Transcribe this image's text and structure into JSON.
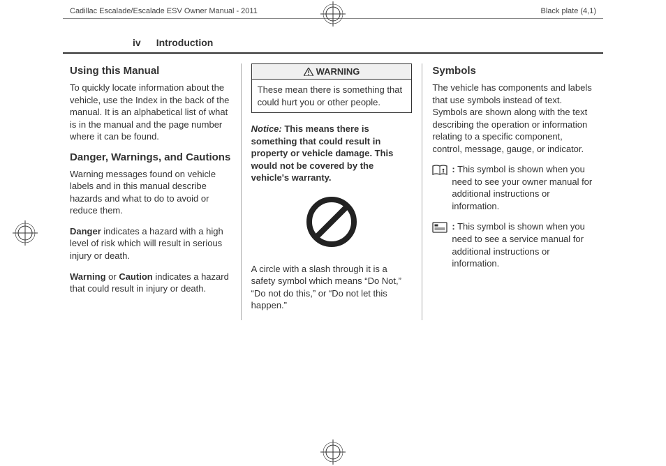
{
  "header": {
    "left": "Cadillac Escalade/Escalade ESV Owner Manual - 2011",
    "right": "Black plate (4,1)"
  },
  "page": {
    "number": "iv",
    "section": "Introduction"
  },
  "col1": {
    "h1": "Using this Manual",
    "p1": "To quickly locate information about the vehicle, use the Index in the back of the manual. It is an alphabetical list of what is in the manual and the page number where it can be found.",
    "h2": "Danger, Warnings, and Cautions",
    "p2": "Warning messages found on vehicle labels and in this manual describe hazards and what to do to avoid or reduce them.",
    "p3a": "Danger",
    "p3b": " indicates a hazard with a high level of risk which will result in serious injury or death.",
    "p4a": "Warning",
    "p4b": " or ",
    "p4c": "Caution",
    "p4d": " indicates a hazard that could result in injury or death."
  },
  "col2": {
    "warning_label": "WARNING",
    "warning_body": "These mean there is something that could hurt you or other people.",
    "notice_label": "Notice:",
    "notice_body": " This means there is something that could result in property or vehicle damage. This would not be covered by the vehicle's warranty.",
    "caption": "A circle with a slash through it is a safety symbol which means “Do Not,” “Do not do this,” or “Do not let this happen.”"
  },
  "col3": {
    "h1": "Symbols",
    "p1": "The vehicle has components and labels that use symbols instead of text. Symbols are shown along with the text describing the operation or information relating to a specific component, control, message, gauge, or indicator.",
    "s1a": ":",
    "s1b": " This symbol is shown when you need to see your owner manual for additional instructions or information.",
    "s2a": ":",
    "s2b": " This symbol is shown when you need to see a service manual for additional instructions or information."
  }
}
